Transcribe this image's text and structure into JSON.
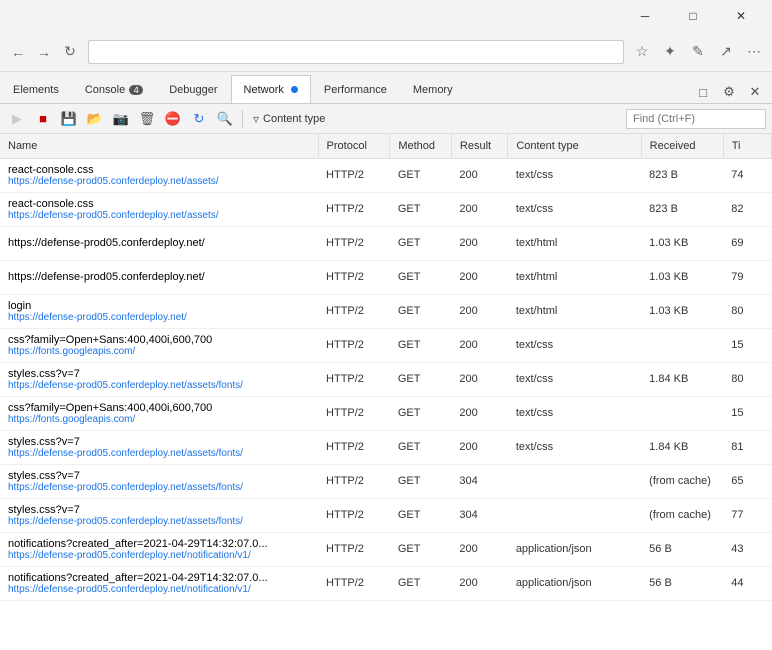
{
  "titlebar": {
    "minimize_label": "─",
    "maximize_label": "□",
    "close_label": "✕"
  },
  "browser_icons": [
    "←",
    "→",
    "↺",
    "⌂",
    "☆",
    "⋆",
    "✎",
    "↗",
    "⋯"
  ],
  "devtools_tabs": [
    {
      "id": "elements",
      "label": "Elements",
      "active": false,
      "badge": null
    },
    {
      "id": "console",
      "label": "Console",
      "active": false,
      "badge": "4"
    },
    {
      "id": "debugger",
      "label": "Debugger",
      "active": false,
      "badge": null
    },
    {
      "id": "network",
      "label": "Network",
      "active": true,
      "badge": null,
      "dot": true
    },
    {
      "id": "performance",
      "label": "Performance",
      "active": false,
      "badge": null
    },
    {
      "id": "memory",
      "label": "Memory",
      "active": false,
      "badge": null
    }
  ],
  "network_toolbar": {
    "content_type_label": "Content type",
    "find_placeholder": "Find (Ctrl+F)"
  },
  "table": {
    "headers": [
      "Name",
      "Protocol",
      "Method",
      "Result",
      "Content type",
      "Received",
      "Ti"
    ],
    "rows": [
      {
        "name": "react-console.css",
        "url": "https://defense-prod05.conferdeploy.net/assets/",
        "protocol": "HTTP/2",
        "method": "GET",
        "result": "200",
        "content_type": "text/css",
        "received": "823 B",
        "ti": "74"
      },
      {
        "name": "react-console.css",
        "url": "https://defense-prod05.conferdeploy.net/assets/",
        "protocol": "HTTP/2",
        "method": "GET",
        "result": "200",
        "content_type": "text/css",
        "received": "823 B",
        "ti": "82"
      },
      {
        "name": "https://defense-prod05.conferdeploy.net/",
        "url": "",
        "protocol": "HTTP/2",
        "method": "GET",
        "result": "200",
        "content_type": "text/html",
        "received": "1.03 KB",
        "ti": "69"
      },
      {
        "name": "https://defense-prod05.conferdeploy.net/",
        "url": "",
        "protocol": "HTTP/2",
        "method": "GET",
        "result": "200",
        "content_type": "text/html",
        "received": "1.03 KB",
        "ti": "79"
      },
      {
        "name": "login",
        "url": "https://defense-prod05.conferdeploy.net/",
        "protocol": "HTTP/2",
        "method": "GET",
        "result": "200",
        "content_type": "text/html",
        "received": "1.03 KB",
        "ti": "80"
      },
      {
        "name": "css?family=Open+Sans:400,400i,600,700",
        "url": "https://fonts.googleapis.com/",
        "protocol": "HTTP/2",
        "method": "GET",
        "result": "200",
        "content_type": "text/css",
        "received": "",
        "ti": "15"
      },
      {
        "name": "styles.css?v=7",
        "url": "https://defense-prod05.conferdeploy.net/assets/fonts/",
        "protocol": "HTTP/2",
        "method": "GET",
        "result": "200",
        "content_type": "text/css",
        "received": "1.84 KB",
        "ti": "80"
      },
      {
        "name": "css?family=Open+Sans:400,400i,600,700",
        "url": "https://fonts.googleapis.com/",
        "protocol": "HTTP/2",
        "method": "GET",
        "result": "200",
        "content_type": "text/css",
        "received": "",
        "ti": "15"
      },
      {
        "name": "styles.css?v=7",
        "url": "https://defense-prod05.conferdeploy.net/assets/fonts/",
        "protocol": "HTTP/2",
        "method": "GET",
        "result": "200",
        "content_type": "text/css",
        "received": "1.84 KB",
        "ti": "81"
      },
      {
        "name": "styles.css?v=7",
        "url": "https://defense-prod05.conferdeploy.net/assets/fonts/",
        "protocol": "HTTP/2",
        "method": "GET",
        "result": "304",
        "content_type": "",
        "received": "(from cache)",
        "ti": "65"
      },
      {
        "name": "styles.css?v=7",
        "url": "https://defense-prod05.conferdeploy.net/assets/fonts/",
        "protocol": "HTTP/2",
        "method": "GET",
        "result": "304",
        "content_type": "",
        "received": "(from cache)",
        "ti": "77"
      },
      {
        "name": "notifications?created_after=2021-04-29T14:32:07.0...",
        "url": "https://defense-prod05.conferdeploy.net/notification/v1/",
        "protocol": "HTTP/2",
        "method": "GET",
        "result": "200",
        "content_type": "application/json",
        "received": "56 B",
        "ti": "43"
      },
      {
        "name": "notifications?created_after=2021-04-29T14:32:07.0...",
        "url": "https://defense-prod05.conferdeploy.net/notification/v1/",
        "protocol": "HTTP/2",
        "method": "GET",
        "result": "200",
        "content_type": "application/json",
        "received": "56 B",
        "ti": "44"
      }
    ]
  }
}
